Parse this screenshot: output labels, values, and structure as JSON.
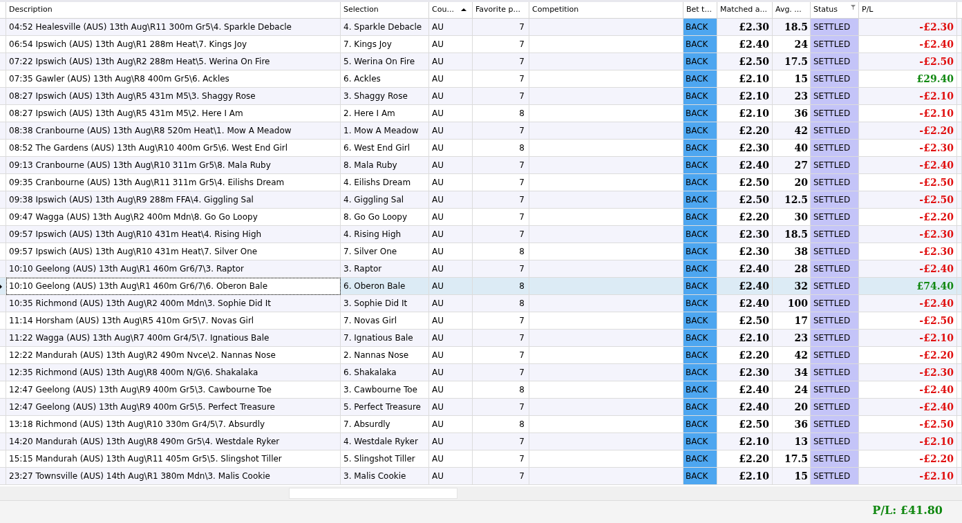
{
  "table": {
    "columns": [
      {
        "label": "Description",
        "sorted": false,
        "filtered": false
      },
      {
        "label": "Selection",
        "sorted": false,
        "filtered": false
      },
      {
        "label": "Cou...",
        "sorted": true,
        "filtered": false
      },
      {
        "label": "Favorite p...",
        "sorted": false,
        "filtered": false
      },
      {
        "label": "Competition",
        "sorted": false,
        "filtered": false
      },
      {
        "label": "Bet t...",
        "sorted": false,
        "filtered": false
      },
      {
        "label": "Matched a...",
        "sorted": false,
        "filtered": false
      },
      {
        "label": "Avg. ...",
        "sorted": false,
        "filtered": false
      },
      {
        "label": "Status",
        "sorted": false,
        "filtered": true
      },
      {
        "label": "P/L",
        "sorted": false,
        "filtered": false
      }
    ],
    "rows": [
      {
        "description": "04:52 Healesville (AUS) 13th Aug\\R11 300m Gr5\\4. Sparkle Debacle",
        "selection": "4. Sparkle Debacle",
        "country": "AU",
        "favorite": "7",
        "bet_type": "BACK",
        "matched": "£2.30",
        "avg": "18.5",
        "status": "SETTLED",
        "pl": "-£2.30",
        "won": false,
        "selected": false
      },
      {
        "description": "06:54 Ipswich (AUS) 13th Aug\\R1 288m Heat\\7. Kings Joy",
        "selection": "7. Kings Joy",
        "country": "AU",
        "favorite": "7",
        "bet_type": "BACK",
        "matched": "£2.40",
        "avg": "24",
        "status": "SETTLED",
        "pl": "-£2.40",
        "won": false,
        "selected": false
      },
      {
        "description": "07:22 Ipswich (AUS) 13th Aug\\R2 288m Heat\\5. Werina On Fire",
        "selection": "5. Werina On Fire",
        "country": "AU",
        "favorite": "7",
        "bet_type": "BACK",
        "matched": "£2.50",
        "avg": "17.5",
        "status": "SETTLED",
        "pl": "-£2.50",
        "won": false,
        "selected": false
      },
      {
        "description": "07:35 Gawler (AUS) 13th Aug\\R8 400m Gr5\\6. Ackles",
        "selection": "6. Ackles",
        "country": "AU",
        "favorite": "7",
        "bet_type": "BACK",
        "matched": "£2.10",
        "avg": "15",
        "status": "SETTLED",
        "pl": "£29.40",
        "won": true,
        "selected": false
      },
      {
        "description": "08:27 Ipswich (AUS) 13th Aug\\R5 431m M5\\3. Shaggy Rose",
        "selection": "3. Shaggy Rose",
        "country": "AU",
        "favorite": "7",
        "bet_type": "BACK",
        "matched": "£2.10",
        "avg": "23",
        "status": "SETTLED",
        "pl": "-£2.10",
        "won": false,
        "selected": false
      },
      {
        "description": "08:27 Ipswich (AUS) 13th Aug\\R5 431m M5\\2. Here I Am",
        "selection": "2. Here I Am",
        "country": "AU",
        "favorite": "8",
        "bet_type": "BACK",
        "matched": "£2.10",
        "avg": "36",
        "status": "SETTLED",
        "pl": "-£2.10",
        "won": false,
        "selected": false
      },
      {
        "description": "08:38 Cranbourne (AUS) 13th Aug\\R8 520m Heat\\1. Mow A Meadow",
        "selection": "1. Mow A Meadow",
        "country": "AU",
        "favorite": "7",
        "bet_type": "BACK",
        "matched": "£2.20",
        "avg": "42",
        "status": "SETTLED",
        "pl": "-£2.20",
        "won": false,
        "selected": false
      },
      {
        "description": "08:52 The Gardens (AUS) 13th Aug\\R10 400m Gr5\\6. West End Girl",
        "selection": "6. West End Girl",
        "country": "AU",
        "favorite": "8",
        "bet_type": "BACK",
        "matched": "£2.30",
        "avg": "40",
        "status": "SETTLED",
        "pl": "-£2.30",
        "won": false,
        "selected": false
      },
      {
        "description": "09:13 Cranbourne (AUS) 13th Aug\\R10 311m Gr5\\8. Mala Ruby",
        "selection": "8. Mala Ruby",
        "country": "AU",
        "favorite": "7",
        "bet_type": "BACK",
        "matched": "£2.40",
        "avg": "27",
        "status": "SETTLED",
        "pl": "-£2.40",
        "won": false,
        "selected": false
      },
      {
        "description": "09:35 Cranbourne (AUS) 13th Aug\\R11 311m Gr5\\4. Eilishs Dream",
        "selection": "4. Eilishs Dream",
        "country": "AU",
        "favorite": "7",
        "bet_type": "BACK",
        "matched": "£2.50",
        "avg": "20",
        "status": "SETTLED",
        "pl": "-£2.50",
        "won": false,
        "selected": false
      },
      {
        "description": "09:38 Ipswich (AUS) 13th Aug\\R9 288m FFA\\4. Giggling Sal",
        "selection": "4. Giggling Sal",
        "country": "AU",
        "favorite": "7",
        "bet_type": "BACK",
        "matched": "£2.50",
        "avg": "12.5",
        "status": "SETTLED",
        "pl": "-£2.50",
        "won": false,
        "selected": false
      },
      {
        "description": "09:47 Wagga (AUS) 13th Aug\\R2 400m Mdn\\8. Go Go Loopy",
        "selection": "8. Go Go Loopy",
        "country": "AU",
        "favorite": "7",
        "bet_type": "BACK",
        "matched": "£2.20",
        "avg": "30",
        "status": "SETTLED",
        "pl": "-£2.20",
        "won": false,
        "selected": false
      },
      {
        "description": "09:57 Ipswich (AUS) 13th Aug\\R10 431m Heat\\4. Rising High",
        "selection": "4. Rising High",
        "country": "AU",
        "favorite": "7",
        "bet_type": "BACK",
        "matched": "£2.30",
        "avg": "18.5",
        "status": "SETTLED",
        "pl": "-£2.30",
        "won": false,
        "selected": false
      },
      {
        "description": "09:57 Ipswich (AUS) 13th Aug\\R10 431m Heat\\7. Silver One",
        "selection": "7. Silver One",
        "country": "AU",
        "favorite": "8",
        "bet_type": "BACK",
        "matched": "£2.30",
        "avg": "38",
        "status": "SETTLED",
        "pl": "-£2.30",
        "won": false,
        "selected": false
      },
      {
        "description": "10:10 Geelong (AUS) 13th Aug\\R1 460m Gr6/7\\3. Raptor",
        "selection": "3. Raptor",
        "country": "AU",
        "favorite": "7",
        "bet_type": "BACK",
        "matched": "£2.40",
        "avg": "28",
        "status": "SETTLED",
        "pl": "-£2.40",
        "won": false,
        "selected": false
      },
      {
        "description": "10:10 Geelong (AUS) 13th Aug\\R1 460m Gr6/7\\6. Oberon Bale",
        "selection": "6. Oberon Bale",
        "country": "AU",
        "favorite": "8",
        "bet_type": "BACK",
        "matched": "£2.40",
        "avg": "32",
        "status": "SETTLED",
        "pl": "£74.40",
        "won": true,
        "selected": true
      },
      {
        "description": "10:35 Richmond (AUS) 13th Aug\\R2 400m Mdn\\3. Sophie Did It",
        "selection": "3. Sophie Did It",
        "country": "AU",
        "favorite": "8",
        "bet_type": "BACK",
        "matched": "£2.40",
        "avg": "100",
        "status": "SETTLED",
        "pl": "-£2.40",
        "won": false,
        "selected": false
      },
      {
        "description": "11:14 Horsham (AUS) 13th Aug\\R5 410m Gr5\\7. Novas Girl",
        "selection": "7. Novas Girl",
        "country": "AU",
        "favorite": "7",
        "bet_type": "BACK",
        "matched": "£2.50",
        "avg": "17",
        "status": "SETTLED",
        "pl": "-£2.50",
        "won": false,
        "selected": false
      },
      {
        "description": "11:22 Wagga (AUS) 13th Aug\\R7 400m Gr4/5\\7. Ignatious Bale",
        "selection": "7. Ignatious Bale",
        "country": "AU",
        "favorite": "7",
        "bet_type": "BACK",
        "matched": "£2.10",
        "avg": "23",
        "status": "SETTLED",
        "pl": "-£2.10",
        "won": false,
        "selected": false
      },
      {
        "description": "12:22 Mandurah (AUS) 13th Aug\\R2 490m Nvce\\2. Nannas Nose",
        "selection": "2. Nannas Nose",
        "country": "AU",
        "favorite": "7",
        "bet_type": "BACK",
        "matched": "£2.20",
        "avg": "42",
        "status": "SETTLED",
        "pl": "-£2.20",
        "won": false,
        "selected": false
      },
      {
        "description": "12:35 Richmond (AUS) 13th Aug\\R8 400m N/G\\6. Shakalaka",
        "selection": "6. Shakalaka",
        "country": "AU",
        "favorite": "7",
        "bet_type": "BACK",
        "matched": "£2.30",
        "avg": "34",
        "status": "SETTLED",
        "pl": "-£2.30",
        "won": false,
        "selected": false
      },
      {
        "description": "12:47 Geelong (AUS) 13th Aug\\R9 400m Gr5\\3. Cawbourne Toe",
        "selection": "3. Cawbourne Toe",
        "country": "AU",
        "favorite": "8",
        "bet_type": "BACK",
        "matched": "£2.40",
        "avg": "24",
        "status": "SETTLED",
        "pl": "-£2.40",
        "won": false,
        "selected": false
      },
      {
        "description": "12:47 Geelong (AUS) 13th Aug\\R9 400m Gr5\\5. Perfect Treasure",
        "selection": "5. Perfect Treasure",
        "country": "AU",
        "favorite": "7",
        "bet_type": "BACK",
        "matched": "£2.40",
        "avg": "20",
        "status": "SETTLED",
        "pl": "-£2.40",
        "won": false,
        "selected": false
      },
      {
        "description": "13:18 Richmond (AUS) 13th Aug\\R10 330m Gr4/5\\7. Absurdly",
        "selection": "7. Absurdly",
        "country": "AU",
        "favorite": "8",
        "bet_type": "BACK",
        "matched": "£2.50",
        "avg": "36",
        "status": "SETTLED",
        "pl": "-£2.50",
        "won": false,
        "selected": false
      },
      {
        "description": "14:20 Mandurah (AUS) 13th Aug\\R8 490m Gr5\\4. Westdale Ryker",
        "selection": "4. Westdale Ryker",
        "country": "AU",
        "favorite": "7",
        "bet_type": "BACK",
        "matched": "£2.10",
        "avg": "13",
        "status": "SETTLED",
        "pl": "-£2.10",
        "won": false,
        "selected": false
      },
      {
        "description": "15:15 Mandurah (AUS) 13th Aug\\R11 405m Gr5\\5. Slingshot Tiller",
        "selection": "5. Slingshot Tiller",
        "country": "AU",
        "favorite": "7",
        "bet_type": "BACK",
        "matched": "£2.20",
        "avg": "17.5",
        "status": "SETTLED",
        "pl": "-£2.20",
        "won": false,
        "selected": false
      },
      {
        "description": "23:27 Townsville (AUS) 14th Aug\\R1 380m Mdn\\3. Malis Cookie",
        "selection": "3. Malis Cookie",
        "country": "AU",
        "favorite": "7",
        "bet_type": "BACK",
        "matched": "£2.10",
        "avg": "15",
        "status": "SETTLED",
        "pl": "-£2.10",
        "won": false,
        "selected": false
      }
    ]
  },
  "footer": {
    "total": "P/L: £41.80",
    "positive": true
  }
}
